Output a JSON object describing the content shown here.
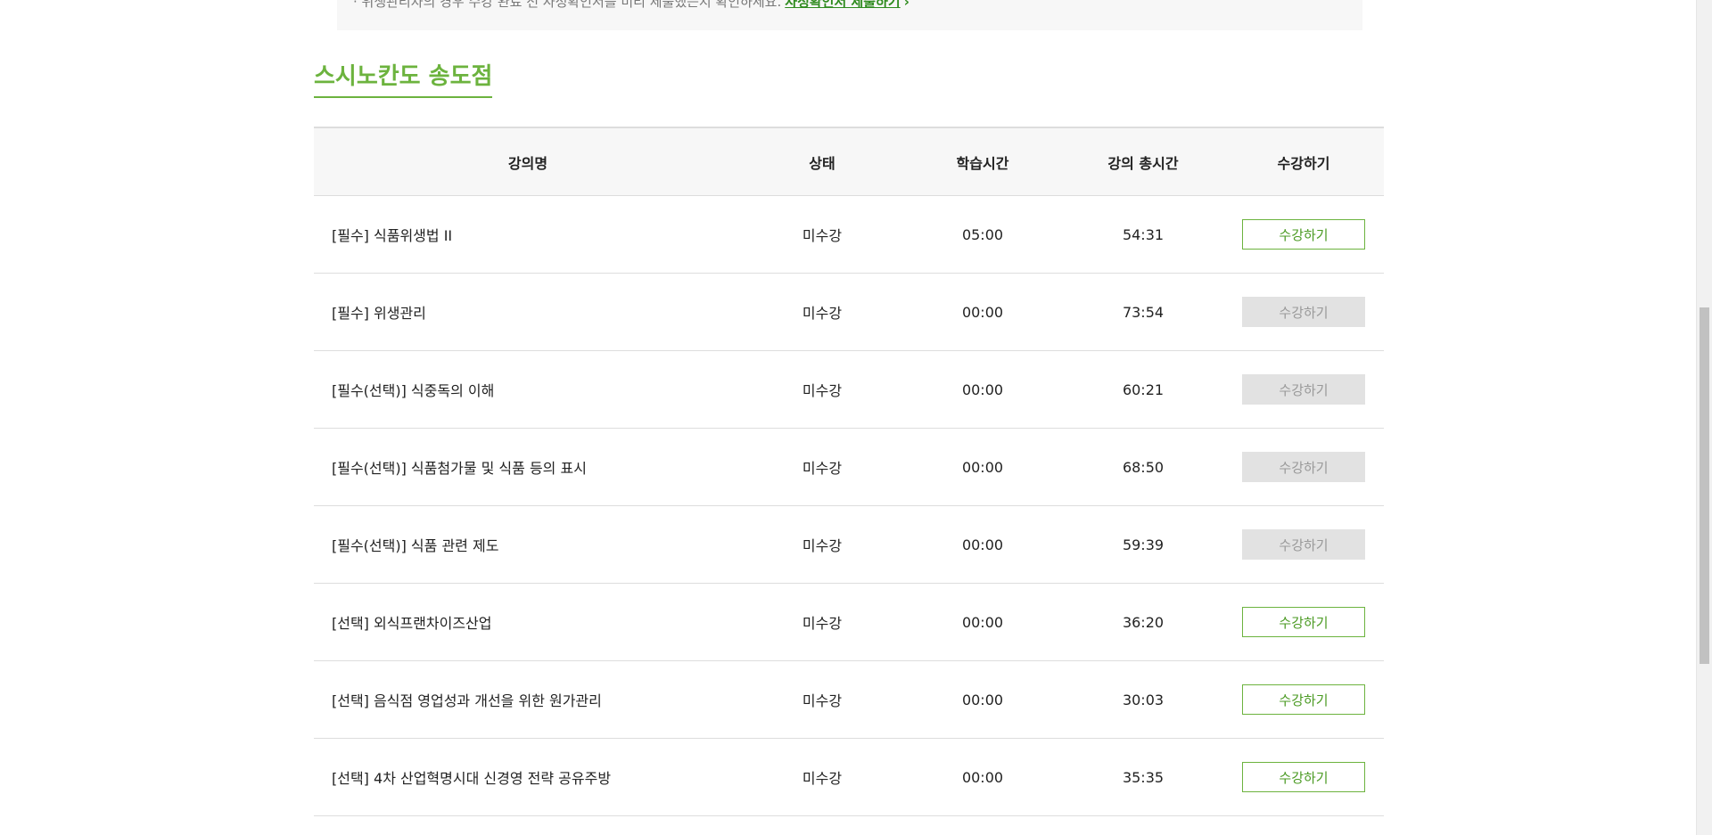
{
  "notice": {
    "text": "· 위생관리자의 경우 수강 완료 전 사정확인서를 미리 제출했는지 확인하세요.",
    "link_label": "사정확인서 제출하기",
    "arrow": "›"
  },
  "section": {
    "title": "스시노칸도 송도점"
  },
  "table": {
    "headers": {
      "title": "강의명",
      "status": "상태",
      "study_time": "학습시간",
      "total_time": "강의 총시간",
      "action": "수강하기"
    },
    "rows": [
      {
        "title": "[필수] 식품위생법 II",
        "status": "미수강",
        "study_time": "05:00",
        "total_time": "54:31",
        "action_label": "수강하기",
        "enabled": true
      },
      {
        "title": "[필수] 위생관리",
        "status": "미수강",
        "study_time": "00:00",
        "total_time": "73:54",
        "action_label": "수강하기",
        "enabled": false
      },
      {
        "title": "[필수(선택)] 식중독의 이해",
        "status": "미수강",
        "study_time": "00:00",
        "total_time": "60:21",
        "action_label": "수강하기",
        "enabled": false
      },
      {
        "title": "[필수(선택)] 식품첨가물 및 식품 등의 표시",
        "status": "미수강",
        "study_time": "00:00",
        "total_time": "68:50",
        "action_label": "수강하기",
        "enabled": false
      },
      {
        "title": "[필수(선택)] 식품 관련 제도",
        "status": "미수강",
        "study_time": "00:00",
        "total_time": "59:39",
        "action_label": "수강하기",
        "enabled": false
      },
      {
        "title": "[선택] 외식프랜차이즈산업",
        "status": "미수강",
        "study_time": "00:00",
        "total_time": "36:20",
        "action_label": "수강하기",
        "enabled": true
      },
      {
        "title": "[선택] 음식점 영업성과 개선을 위한 원가관리",
        "status": "미수강",
        "study_time": "00:00",
        "total_time": "30:03",
        "action_label": "수강하기",
        "enabled": true
      },
      {
        "title": "[선택] 4차 산업혁명시대 신경영 전략 공유주방",
        "status": "미수강",
        "study_time": "00:00",
        "total_time": "35:35",
        "action_label": "수강하기",
        "enabled": true
      }
    ]
  },
  "colors": {
    "accent": "#6cb33e",
    "link": "#2e8b1e",
    "disabled_bg": "#e2e2e2"
  }
}
